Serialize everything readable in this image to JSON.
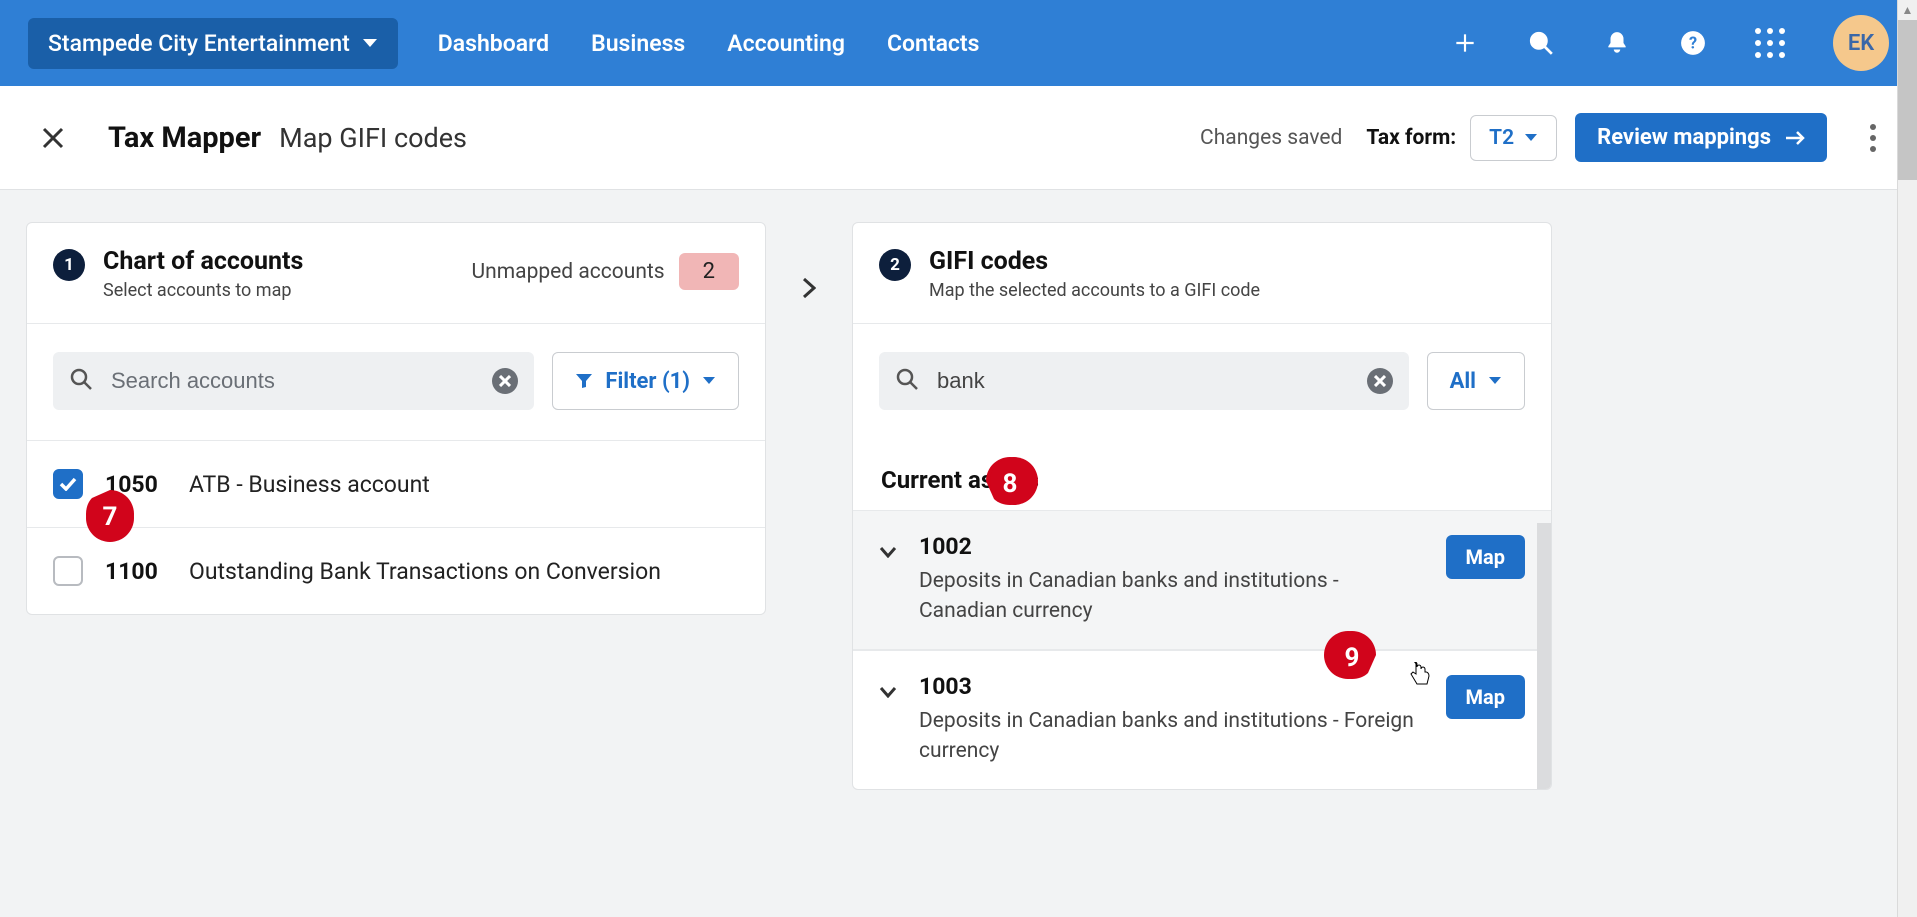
{
  "topbar": {
    "org_name": "Stampede City Entertainment",
    "nav": [
      "Dashboard",
      "Business",
      "Accounting",
      "Contacts"
    ],
    "avatar_initials": "EK"
  },
  "subheader": {
    "title": "Tax Mapper",
    "subtitle": "Map GIFI codes",
    "changes_saved": "Changes saved",
    "tax_form_label": "Tax form:",
    "tax_form_value": "T2",
    "review_label": "Review mappings"
  },
  "left_panel": {
    "step": "1",
    "title": "Chart of accounts",
    "subtitle": "Select accounts to map",
    "unmapped_label": "Unmapped accounts",
    "unmapped_count": "2",
    "search_placeholder": "Search accounts",
    "filter_label": "Filter (1)",
    "accounts": [
      {
        "code": "1050",
        "name": "ATB - Business account",
        "checked": true
      },
      {
        "code": "1100",
        "name": "Outstanding Bank Transactions on Conversion",
        "checked": false
      }
    ]
  },
  "right_panel": {
    "step": "2",
    "title": "GIFI codes",
    "subtitle": "Map the selected accounts to a GIFI code",
    "search_value": "bank",
    "all_label": "All",
    "section_label": "Current assets",
    "map_label": "Map",
    "codes": [
      {
        "code": "1002",
        "desc": "Deposits in Canadian banks and institutions - Canadian currency",
        "highlight": true
      },
      {
        "code": "1003",
        "desc": "Deposits in Canadian banks and institutions - Foreign currency",
        "highlight": false
      }
    ]
  },
  "callouts": {
    "seven": "7",
    "eight": "8",
    "nine": "9"
  }
}
